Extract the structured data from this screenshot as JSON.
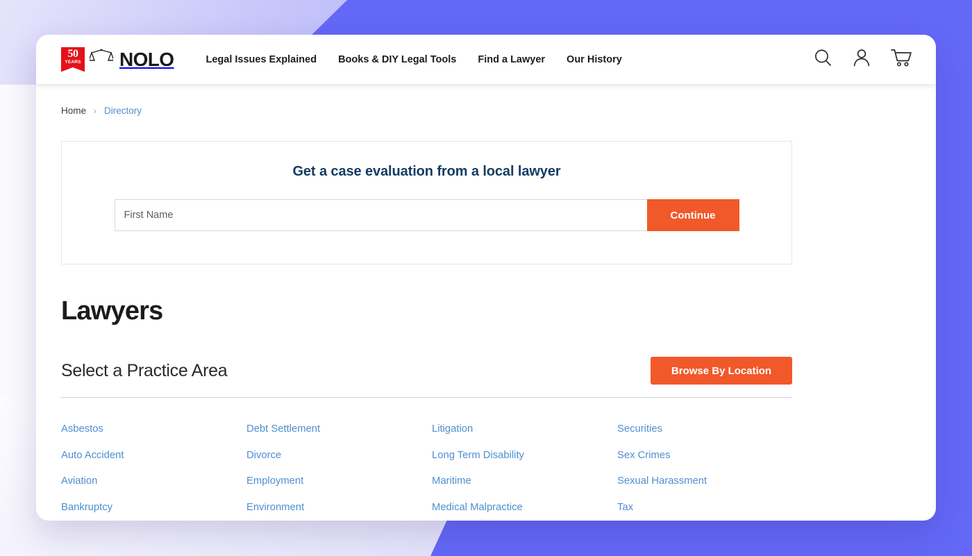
{
  "brand": {
    "badge_number": "50",
    "badge_label": "YEARS",
    "wordmark": "NOLO",
    "scales_icon": "scales-of-justice-icon"
  },
  "header": {
    "nav": [
      {
        "label": "Legal Issues Explained"
      },
      {
        "label": "Books & DIY Legal Tools"
      },
      {
        "label": "Find a Lawyer"
      },
      {
        "label": "Our History"
      }
    ],
    "icons": [
      {
        "name": "search-icon"
      },
      {
        "name": "user-account-icon"
      },
      {
        "name": "shopping-cart-icon"
      }
    ]
  },
  "breadcrumb": {
    "home": "Home",
    "separator": "›",
    "current": "Directory"
  },
  "eval_card": {
    "title": "Get a case evaluation from a local lawyer",
    "input_placeholder": "First Name",
    "input_value": "",
    "submit_label": "Continue"
  },
  "page": {
    "title": "Lawyers",
    "section_title": "Select a Practice Area",
    "browse_button": "Browse By Location"
  },
  "practice_areas": {
    "columns": [
      [
        "Asbestos",
        "Auto Accident",
        "Aviation",
        "Bankruptcy"
      ],
      [
        "Debt Settlement",
        "Divorce",
        "Employment",
        "Environment"
      ],
      [
        "Litigation",
        "Long Term Disability",
        "Maritime",
        "Medical Malpractice"
      ],
      [
        "Securities",
        "Sex Crimes",
        "Sexual Harassment",
        "Tax"
      ]
    ]
  },
  "colors": {
    "accent_orange": "#F1592A",
    "link_blue": "#4E8FD0",
    "heading_navy": "#143C63",
    "background_purple": "#6468F7",
    "brand_red": "#E4121A"
  }
}
